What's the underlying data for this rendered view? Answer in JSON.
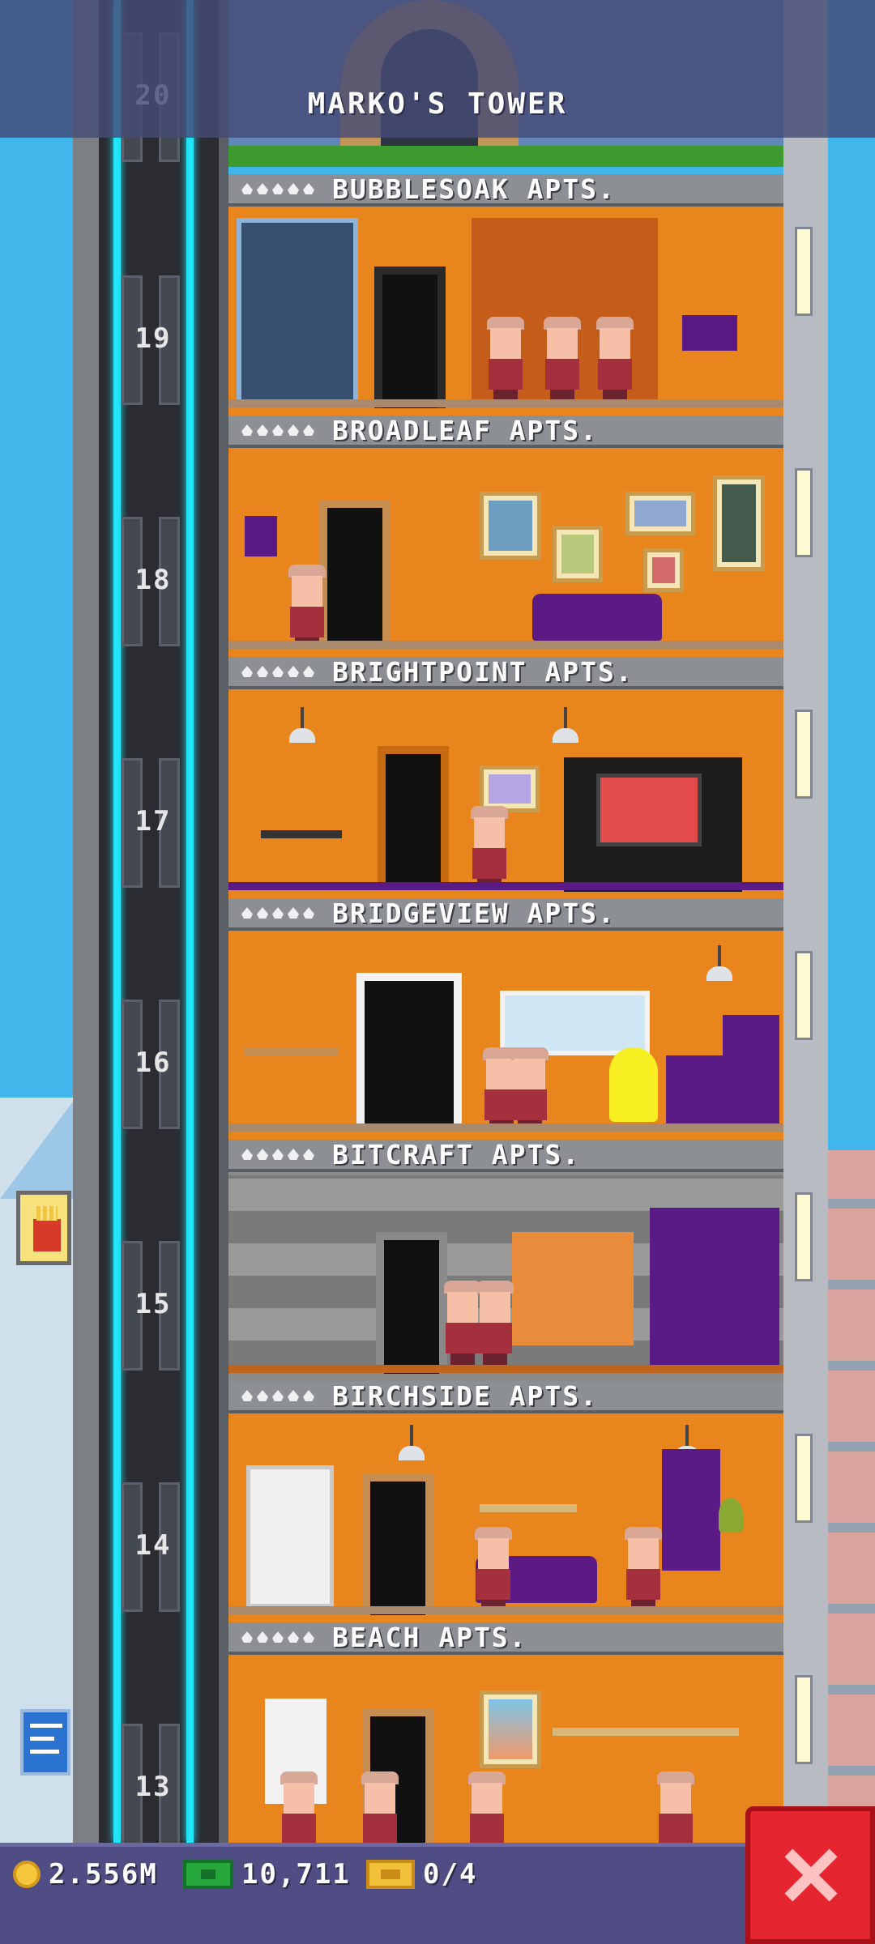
{
  "tower": {
    "title": "MARKO'S TOWER"
  },
  "floors": [
    {
      "number": "20",
      "name": ""
    },
    {
      "number": "19",
      "name": "BUBBLESOAK APTS."
    },
    {
      "number": "18",
      "name": "BROADLEAF APTS."
    },
    {
      "number": "17",
      "name": "BRIGHTPOINT APTS."
    },
    {
      "number": "16",
      "name": "BRIDGEVIEW APTS."
    },
    {
      "number": "15",
      "name": "BITCRAFT APTS."
    },
    {
      "number": "14",
      "name": "BIRCHSIDE APTS."
    },
    {
      "number": "13",
      "name": "BEACH APTS."
    }
  ],
  "stats": {
    "coins": "2.556M",
    "bux": "10,711",
    "tickets": "0/4"
  },
  "icons": {
    "coins": "coin-icon",
    "bux": "bux-icon",
    "tickets": "ticket-icon",
    "close": "close-icon",
    "stars": "star-icon"
  },
  "colors": {
    "sky": "#40b6ea",
    "floor_orange": "#e8851d",
    "elevator_cable": "#22e3f7",
    "close_button": "#e5252f",
    "topbar": "#464a76",
    "bottombar": "#4f4d83"
  }
}
